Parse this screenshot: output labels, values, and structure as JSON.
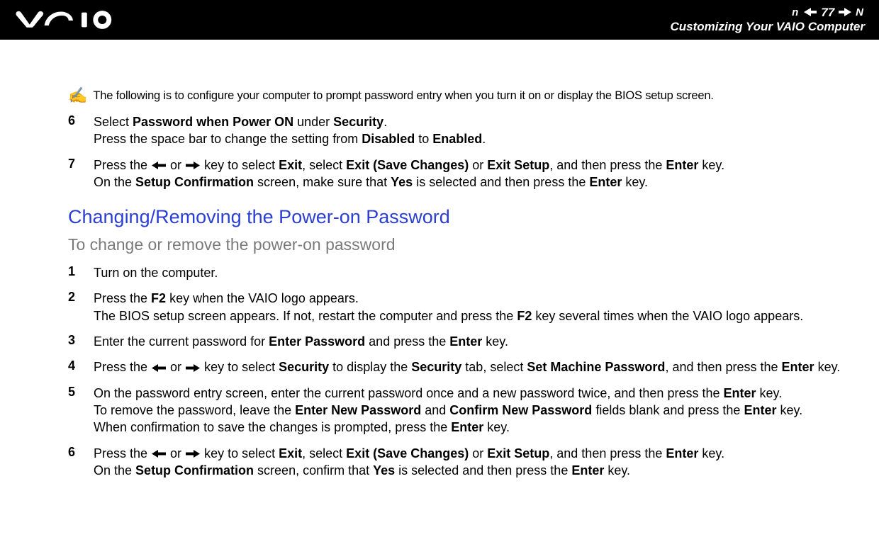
{
  "header": {
    "page_number": "77",
    "section_label": "Customizing Your VAIO Computer"
  },
  "note": {
    "text": "The following is to configure your computer to prompt password entry when you turn it on or display the BIOS setup screen."
  },
  "top_steps": [
    {
      "num": "6",
      "line1_pre": "Select ",
      "b1": "Password when Power ON",
      "mid1": " under ",
      "b2": "Security",
      "post1": ".",
      "line2_pre": "Press the space bar to change the setting from ",
      "b3": "Disabled",
      "mid2": " to ",
      "b4": "Enabled",
      "post2": "."
    },
    {
      "num": "7",
      "l1_a": "Press the ",
      "l1_b": " or ",
      "l1_c": " key to select ",
      "l1_bold1": "Exit",
      "l1_d": ", select ",
      "l1_bold2": "Exit (Save Changes)",
      "l1_e": " or ",
      "l1_bold3": "Exit Setup",
      "l1_f": ", and then press the ",
      "l1_bold4": "Enter",
      "l1_g": " key.",
      "l2_a": "On the ",
      "l2_bold1": "Setup Confirmation",
      "l2_b": " screen, make sure that ",
      "l2_bold2": "Yes",
      "l2_c": " is selected and then press the ",
      "l2_bold3": "Enter",
      "l2_d": " key."
    }
  ],
  "section_title": "Changing/Removing the Power-on Password",
  "sub_title": "To change or remove the power-on password",
  "steps": [
    {
      "num": "1",
      "plain": "Turn on the computer."
    },
    {
      "num": "2",
      "a": "Press the ",
      "b1": "F2",
      "b": " key when the VAIO logo appears.",
      "c": "The BIOS setup screen appears. If not, restart the computer and press the ",
      "b2": "F2",
      "d": " key several times when the VAIO logo appears."
    },
    {
      "num": "3",
      "a": "Enter the current password for ",
      "b1": "Enter Password",
      "b": " and press the ",
      "b2": "Enter",
      "c": " key."
    },
    {
      "num": "4",
      "a": "Press the ",
      "b": " or ",
      "c": " key to select ",
      "b1": "Security",
      "d": " to display the ",
      "b2": "Security",
      "e": " tab, select ",
      "b3": "Set Machine Password",
      "f": ", and then press the ",
      "b4": "Enter",
      "g": " key."
    },
    {
      "num": "5",
      "a": "On the password entry screen, enter the current password once and a new password twice, and then press the ",
      "b1": "Enter",
      "b": " key.",
      "c": "To remove the password, leave the ",
      "b2": "Enter New Password",
      "d": " and ",
      "b3": "Confirm New Password",
      "e": " fields blank and press the ",
      "b4": "Enter",
      "f": " key.",
      "g": "When confirmation to save the changes is prompted, press the ",
      "b5": "Enter",
      "h": " key."
    },
    {
      "num": "6",
      "a": "Press the ",
      "b": " or ",
      "c": " key to select ",
      "b1": "Exit",
      "d": ", select ",
      "b2": "Exit (Save Changes)",
      "e": " or ",
      "b3": "Exit Setup",
      "f": ", and then press the ",
      "b4": "Enter",
      "g": " key.",
      "h": "On the ",
      "b5": "Setup Confirmation",
      "i": " screen, confirm that ",
      "b6": "Yes",
      "j": " is selected and then press the ",
      "b7": "Enter",
      "k": " key."
    }
  ]
}
